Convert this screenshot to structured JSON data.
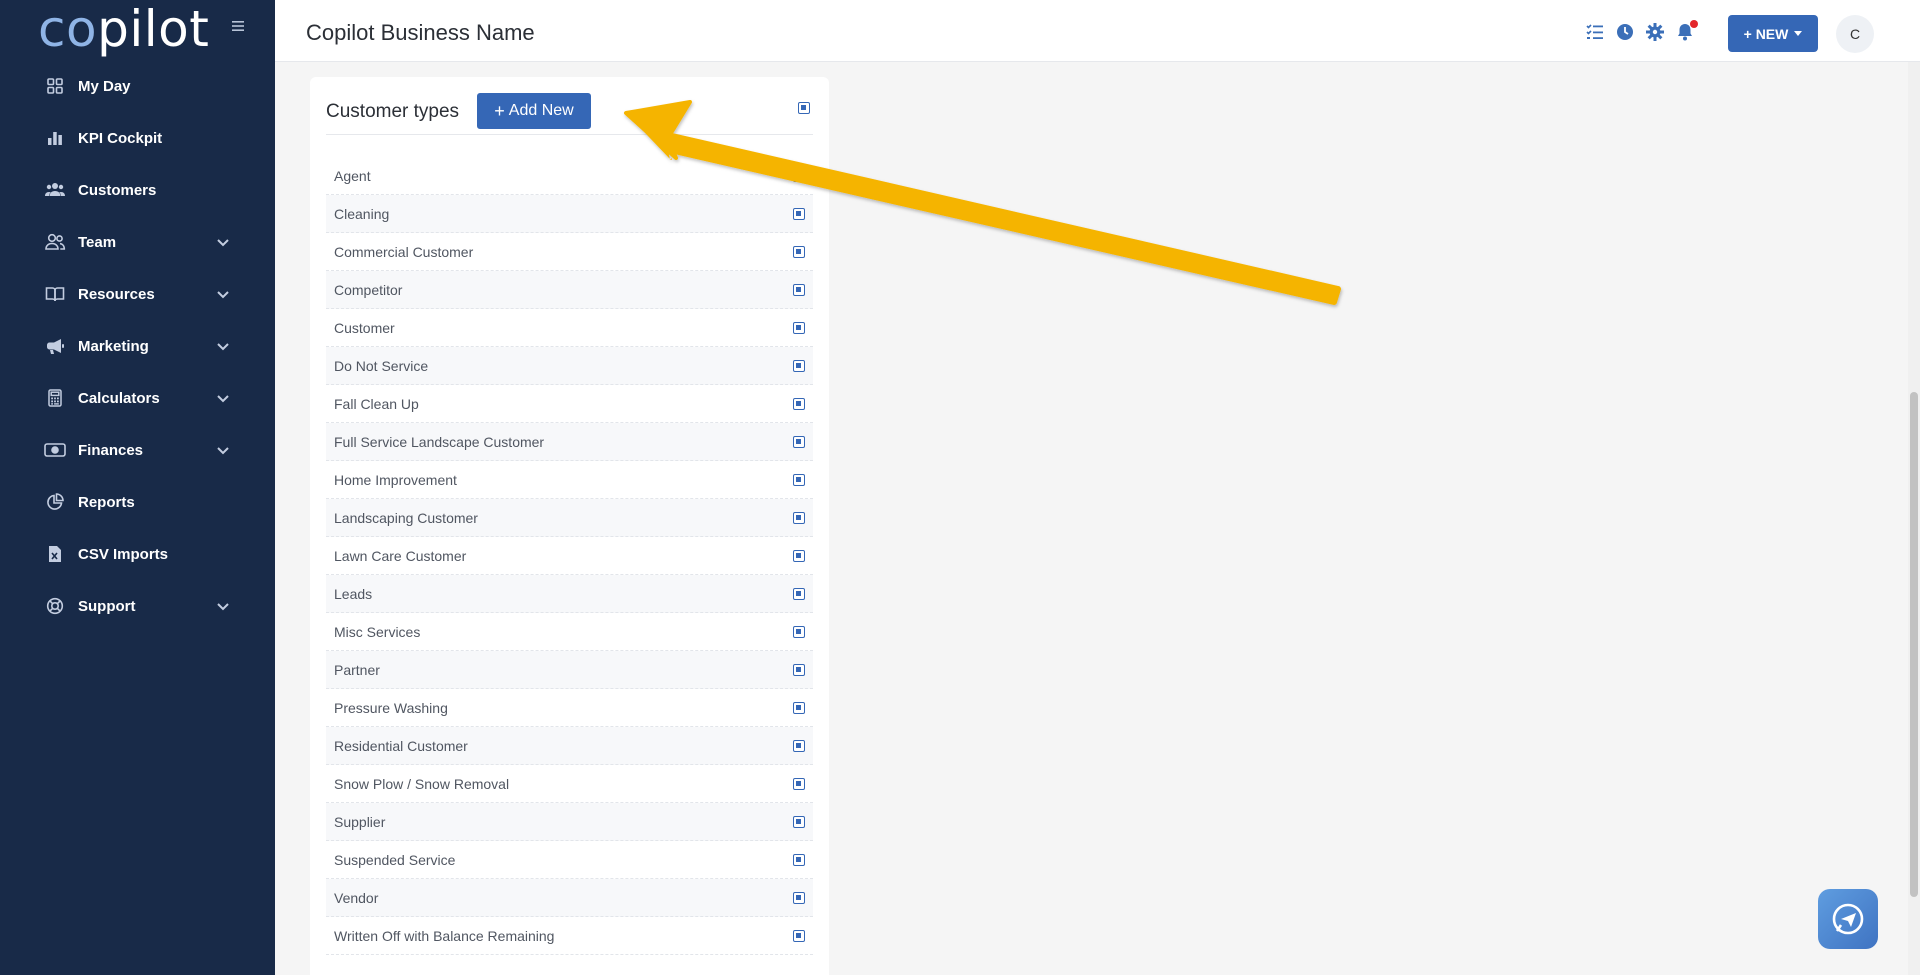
{
  "app": {
    "logo_text_a": "co",
    "logo_text_b": "pilot"
  },
  "sidebar": {
    "items": [
      {
        "label": "My Day",
        "icon": "grid-icon",
        "has_chevron": false
      },
      {
        "label": "KPI Cockpit",
        "icon": "bar-chart-icon",
        "has_chevron": false
      },
      {
        "label": "Customers",
        "icon": "users-icon",
        "has_chevron": false
      },
      {
        "label": "Team",
        "icon": "user-group-icon",
        "has_chevron": true
      },
      {
        "label": "Resources",
        "icon": "book-icon",
        "has_chevron": true
      },
      {
        "label": "Marketing",
        "icon": "megaphone-icon",
        "has_chevron": true
      },
      {
        "label": "Calculators",
        "icon": "calculator-icon",
        "has_chevron": true
      },
      {
        "label": "Finances",
        "icon": "money-icon",
        "has_chevron": true
      },
      {
        "label": "Reports",
        "icon": "pie-chart-icon",
        "has_chevron": false
      },
      {
        "label": "CSV Imports",
        "icon": "file-excel-icon",
        "has_chevron": false
      },
      {
        "label": "Support",
        "icon": "lifebuoy-icon",
        "has_chevron": true
      }
    ]
  },
  "header": {
    "title": "Copilot Business Name",
    "new_label": "+ NEW",
    "avatar_initial": "C"
  },
  "card": {
    "title": "Customer types",
    "add_label": "Add New",
    "add_plus": "+",
    "rows": [
      "Agent",
      "Cleaning",
      "Commercial Customer",
      "Competitor",
      "Customer",
      "Do Not Service",
      "Fall Clean Up",
      "Full Service Landscape Customer",
      "Home Improvement",
      "Landscaping Customer",
      "Lawn Care Customer",
      "Leads",
      "Misc Services",
      "Partner",
      "Pressure Washing",
      "Residential Customer",
      "Snow Plow / Snow Removal",
      "Supplier",
      "Suspended Service",
      "Vendor",
      "Written Off with Balance Remaining"
    ]
  },
  "colors": {
    "sidebar_bg": "#182a48",
    "accent": "#3567b6",
    "arrow": "#f5b400",
    "notification": "#e3262b"
  }
}
